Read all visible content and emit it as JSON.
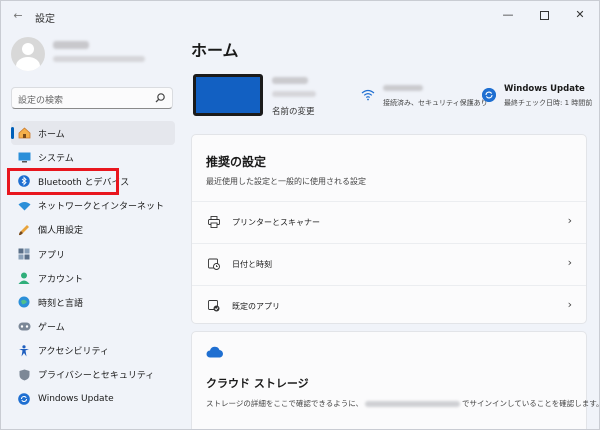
{
  "window": {
    "title": "設定"
  },
  "sidebar": {
    "search_placeholder": "設定の検索",
    "items": [
      {
        "label": "ホーム",
        "icon": "home-icon"
      },
      {
        "label": "システム",
        "icon": "system-icon"
      },
      {
        "label": "Bluetooth とデバイス",
        "icon": "bluetooth-icon"
      },
      {
        "label": "ネットワークとインターネット",
        "icon": "network-icon"
      },
      {
        "label": "個人用設定",
        "icon": "personalization-icon"
      },
      {
        "label": "アプリ",
        "icon": "apps-icon"
      },
      {
        "label": "アカウント",
        "icon": "account-icon"
      },
      {
        "label": "時刻と言語",
        "icon": "time-language-icon"
      },
      {
        "label": "ゲーム",
        "icon": "gaming-icon"
      },
      {
        "label": "アクセシビリティ",
        "icon": "accessibility-icon"
      },
      {
        "label": "プライバシーとセキュリティ",
        "icon": "privacy-icon"
      },
      {
        "label": "Windows Update",
        "icon": "windows-update-icon"
      }
    ]
  },
  "main": {
    "title": "ホーム",
    "device": {
      "rename_label": "名前の変更"
    },
    "network": {
      "status": "接続済み、セキュリティ保護あり"
    },
    "update": {
      "title": "Windows Update",
      "subtitle": "最終チェック日時: 1 時間前"
    },
    "recommended": {
      "title": "推奨の設定",
      "subtitle": "最近使用した設定と一般的に使用される設定",
      "rows": [
        {
          "label": "プリンターとスキャナー",
          "icon": "printer-icon"
        },
        {
          "label": "日付と時刻",
          "icon": "clock-icon"
        },
        {
          "label": "既定のアプリ",
          "icon": "default-apps-icon"
        }
      ]
    },
    "cloud": {
      "title": "クラウド ストレージ",
      "text_before": "ストレージの詳細をここで確認できるように、",
      "text_after": "でサインインしていることを確認します。"
    }
  },
  "colors": {
    "accent": "#005fb8",
    "highlight": "#e8161e",
    "device": "#1260c2"
  }
}
